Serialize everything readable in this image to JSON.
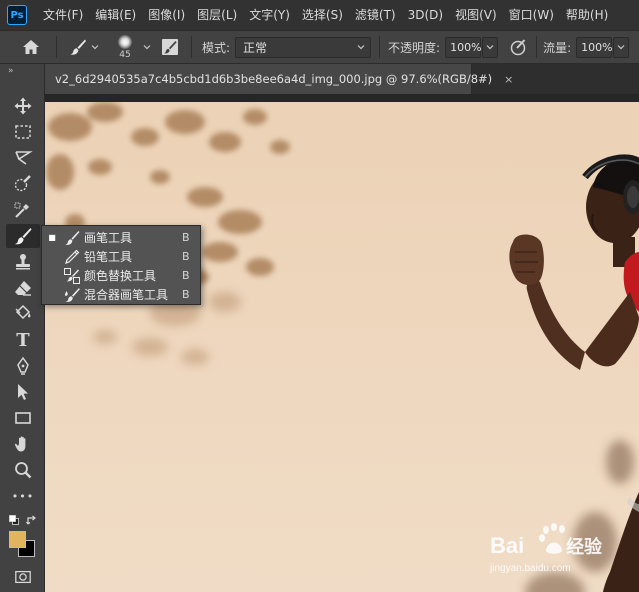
{
  "app": {
    "logo": "Ps"
  },
  "menu": [
    "文件(F)",
    "编辑(E)",
    "图像(I)",
    "图层(L)",
    "文字(Y)",
    "选择(S)",
    "滤镜(T)",
    "3D(D)",
    "视图(V)",
    "窗口(W)",
    "帮助(H)"
  ],
  "options": {
    "home_icon": "home-icon",
    "tool_icon": "brush-icon",
    "brush_size": "45",
    "mode_label": "模式:",
    "mode_value": "正常",
    "opacity_label": "不透明度:",
    "opacity_value": "100%",
    "flow_label": "流量:",
    "flow_value": "100%"
  },
  "document": {
    "tab_title": "v2_6d2940535a7c4b5cbd1d6b3be8ee6a4d_img_000.jpg @ 97.6%(RGB/8#)",
    "close": "×"
  },
  "toolbar": {
    "collapse": "»",
    "tools": [
      "move-tool",
      "marquee-tool",
      "lasso-tool",
      "quick-select-tool",
      "eyedropper-tool",
      "brush-tool",
      "stamp-tool",
      "eraser-tool",
      "paint-bucket-tool",
      "type-tool",
      "pen-tool",
      "path-select-tool",
      "rectangle-tool",
      "hand-tool",
      "zoom-tool",
      "more-tools"
    ],
    "type_glyph": "T",
    "more_glyph": "•••"
  },
  "colors": {
    "foreground": "#e3b45e",
    "background": "#000000",
    "accent": "#31a8ff"
  },
  "flyout": {
    "items": [
      {
        "label": "画笔工具",
        "key": "B",
        "active": true,
        "icon": "brush-icon"
      },
      {
        "label": "铅笔工具",
        "key": "B",
        "active": false,
        "icon": "pencil-icon"
      },
      {
        "label": "颜色替换工具",
        "key": "B",
        "active": false,
        "icon": "color-replacement-icon"
      },
      {
        "label": "混合器画笔工具",
        "key": "B",
        "active": false,
        "icon": "mixer-brush-icon"
      }
    ],
    "bullet": "■"
  },
  "watermark": {
    "brand": "Bai",
    "brand2": "经验",
    "url": "jingyan.baidu.com"
  }
}
